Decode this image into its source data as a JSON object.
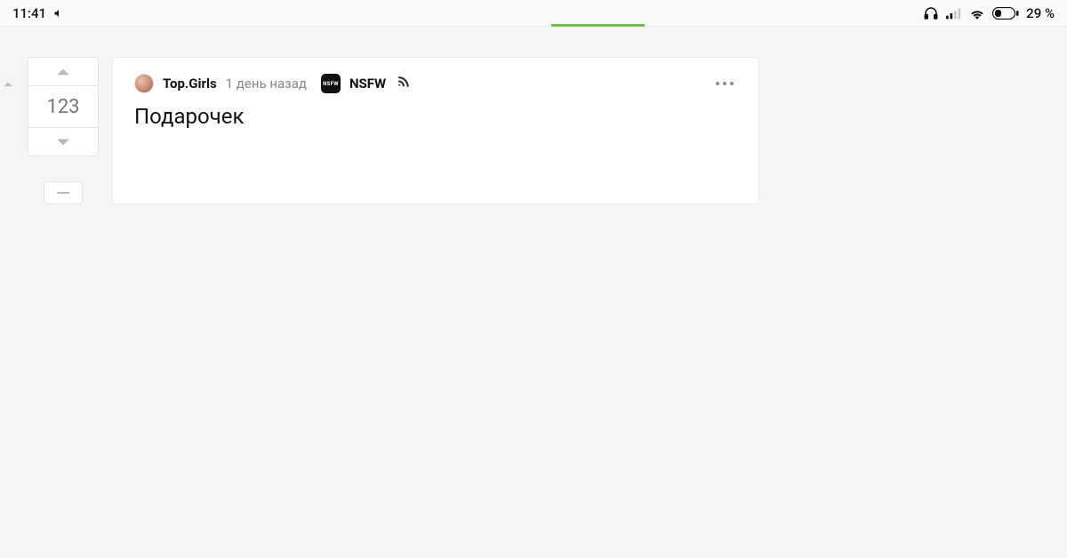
{
  "statusbar": {
    "time": "11:41",
    "battery_text": "29 %"
  },
  "vote": {
    "count": "123"
  },
  "post": {
    "author": "Top.Girls",
    "time_ago": "1 день назад",
    "nsfw_badge_text": "NSFW",
    "nsfw_label": "NSFW",
    "title": "Подарочек"
  }
}
